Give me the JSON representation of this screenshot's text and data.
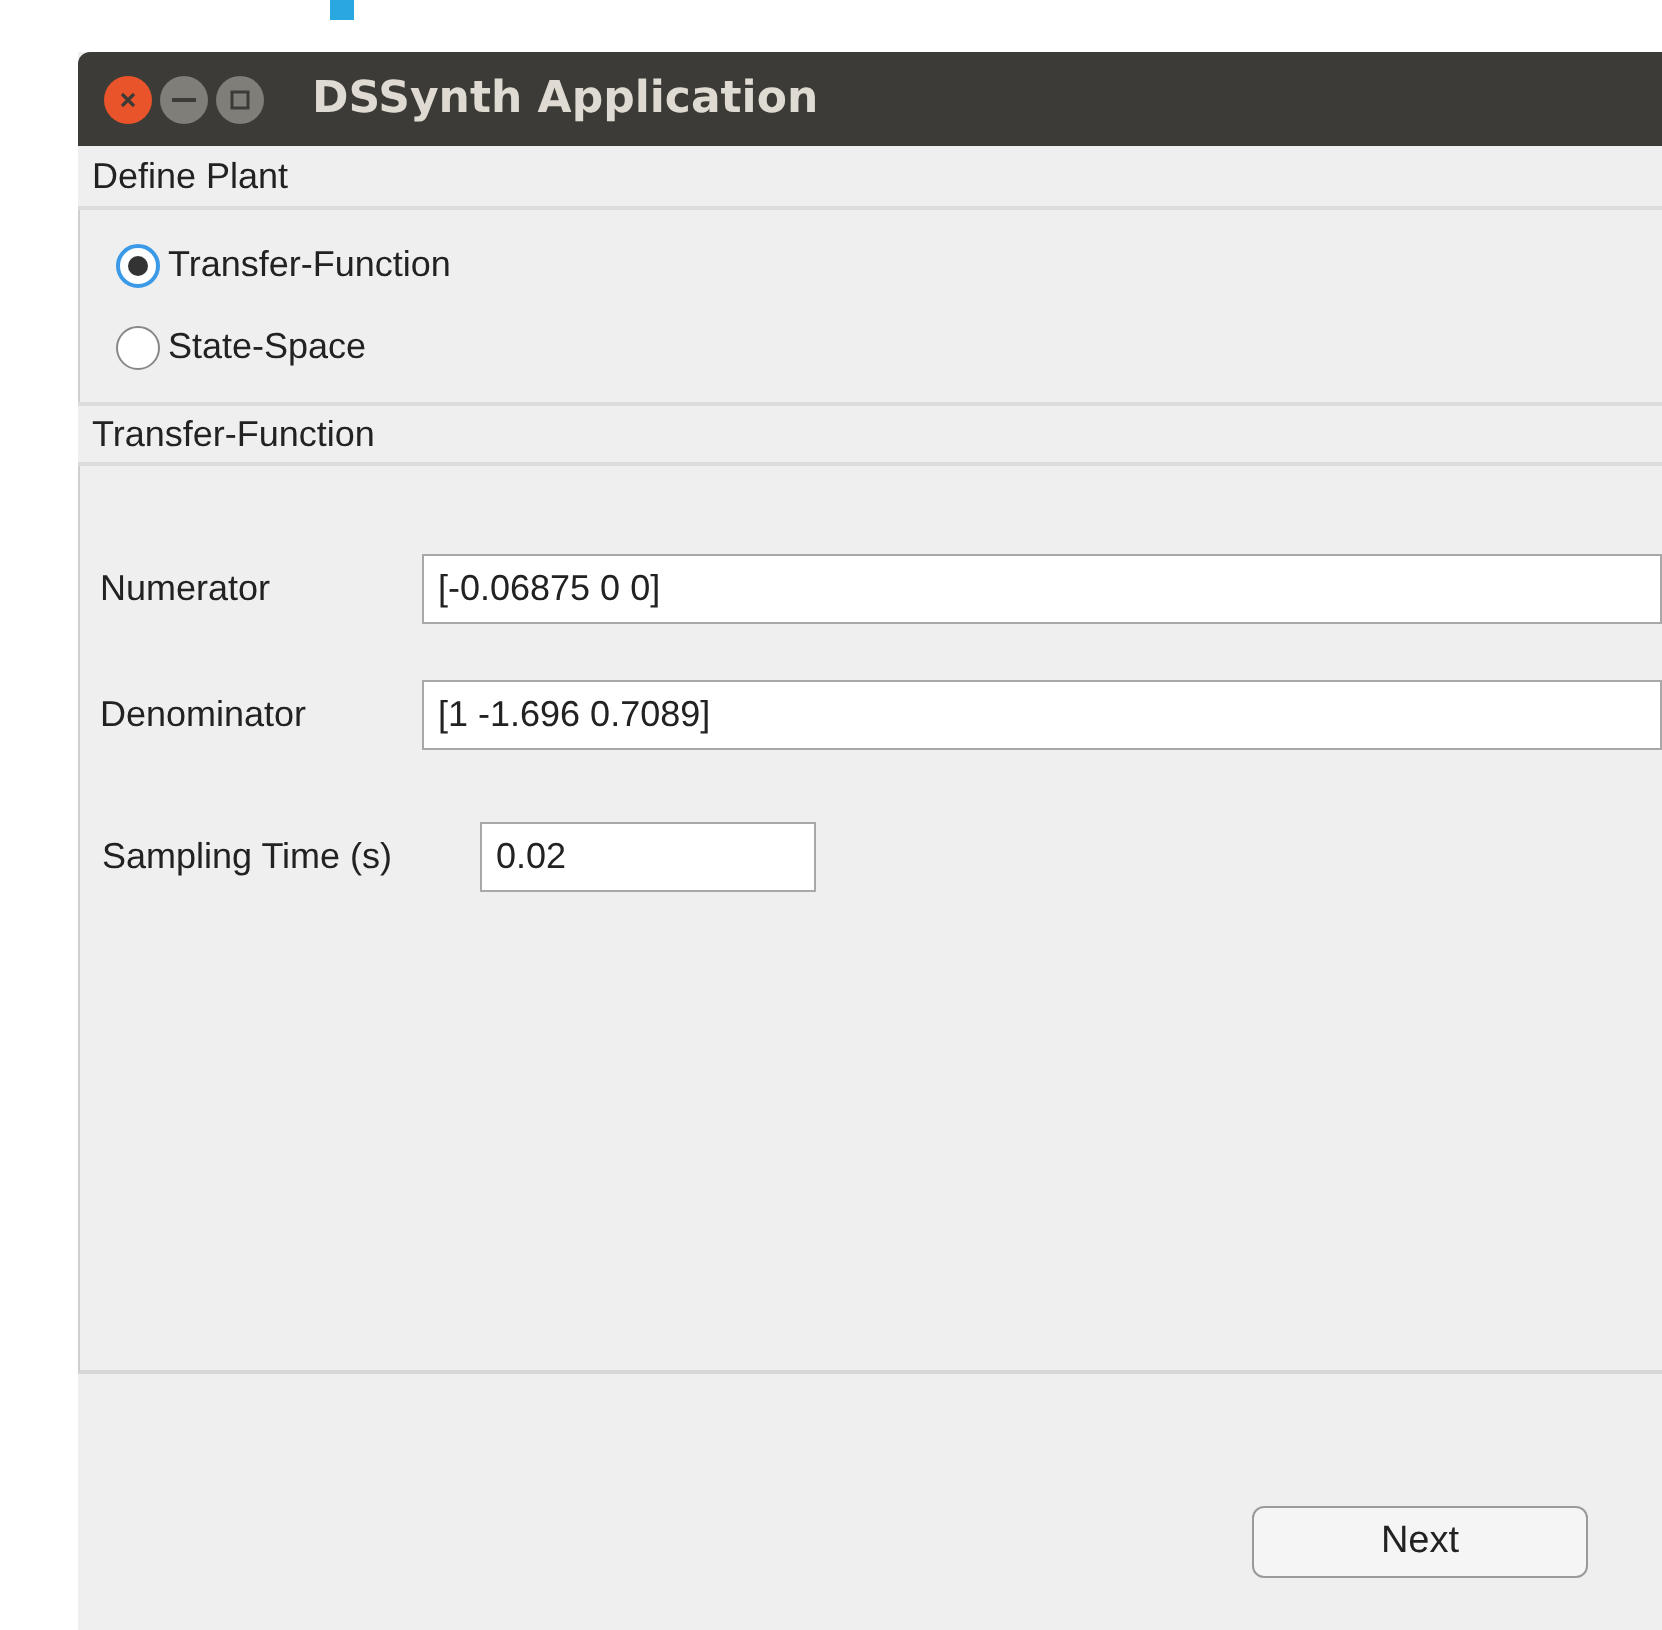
{
  "window": {
    "title": "DSSynth Application"
  },
  "plant_section": {
    "title": "Define Plant",
    "options": [
      {
        "label": "Transfer-Function",
        "selected": true
      },
      {
        "label": "State-Space",
        "selected": false
      }
    ]
  },
  "transfer_function": {
    "title": "Transfer-Function",
    "fields": [
      {
        "kind": "wide",
        "label": "Numerator",
        "value": "[-0.06875 0 0]"
      },
      {
        "kind": "wide",
        "label": "Denominator",
        "value": "[1 -1.696 0.7089]"
      },
      {
        "kind": "short",
        "label": "Sampling Time (s)",
        "value": "0.02"
      }
    ]
  },
  "buttons": [
    "Next"
  ]
}
